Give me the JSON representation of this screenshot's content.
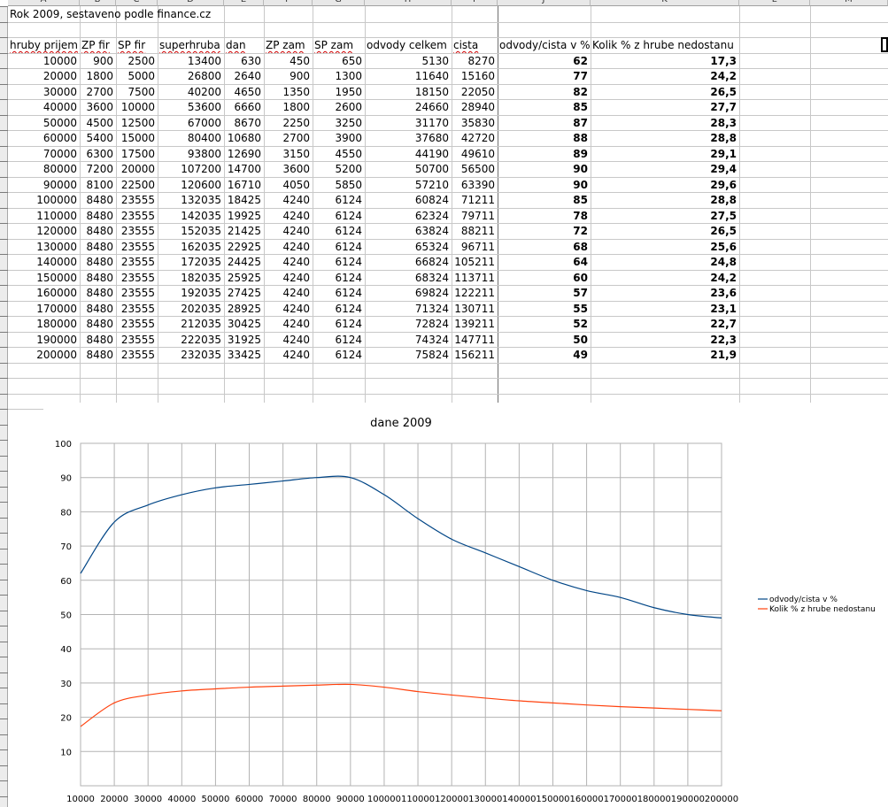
{
  "columns": [
    "A",
    "B",
    "C",
    "D",
    "E",
    "F",
    "G",
    "H",
    "I",
    "J",
    "K",
    "L",
    "M"
  ],
  "title_cell": "Rok 2009, sestaveno podle finance.cz",
  "headers": [
    "hruby prijem",
    "ZP fir",
    "SP fir",
    "superhruba",
    "dan",
    "ZP zam",
    "SP zam",
    "odvody celkem",
    "cista",
    "odvody/cista v %",
    "Kolik % z hrube nedostanu"
  ],
  "rows": [
    [
      "10000",
      "900",
      "2500",
      "13400",
      "630",
      "450",
      "650",
      "5130",
      "8270",
      "62",
      "17,3"
    ],
    [
      "20000",
      "1800",
      "5000",
      "26800",
      "2640",
      "900",
      "1300",
      "11640",
      "15160",
      "77",
      "24,2"
    ],
    [
      "30000",
      "2700",
      "7500",
      "40200",
      "4650",
      "1350",
      "1950",
      "18150",
      "22050",
      "82",
      "26,5"
    ],
    [
      "40000",
      "3600",
      "10000",
      "53600",
      "6660",
      "1800",
      "2600",
      "24660",
      "28940",
      "85",
      "27,7"
    ],
    [
      "50000",
      "4500",
      "12500",
      "67000",
      "8670",
      "2250",
      "3250",
      "31170",
      "35830",
      "87",
      "28,3"
    ],
    [
      "60000",
      "5400",
      "15000",
      "80400",
      "10680",
      "2700",
      "3900",
      "37680",
      "42720",
      "88",
      "28,8"
    ],
    [
      "70000",
      "6300",
      "17500",
      "93800",
      "12690",
      "3150",
      "4550",
      "44190",
      "49610",
      "89",
      "29,1"
    ],
    [
      "80000",
      "7200",
      "20000",
      "107200",
      "14700",
      "3600",
      "5200",
      "50700",
      "56500",
      "90",
      "29,4"
    ],
    [
      "90000",
      "8100",
      "22500",
      "120600",
      "16710",
      "4050",
      "5850",
      "57210",
      "63390",
      "90",
      "29,6"
    ],
    [
      "100000",
      "8480",
      "23555",
      "132035",
      "18425",
      "4240",
      "6124",
      "60824",
      "71211",
      "85",
      "28,8"
    ],
    [
      "110000",
      "8480",
      "23555",
      "142035",
      "19925",
      "4240",
      "6124",
      "62324",
      "79711",
      "78",
      "27,5"
    ],
    [
      "120000",
      "8480",
      "23555",
      "152035",
      "21425",
      "4240",
      "6124",
      "63824",
      "88211",
      "72",
      "26,5"
    ],
    [
      "130000",
      "8480",
      "23555",
      "162035",
      "22925",
      "4240",
      "6124",
      "65324",
      "96711",
      "68",
      "25,6"
    ],
    [
      "140000",
      "8480",
      "23555",
      "172035",
      "24425",
      "4240",
      "6124",
      "66824",
      "105211",
      "64",
      "24,8"
    ],
    [
      "150000",
      "8480",
      "23555",
      "182035",
      "25925",
      "4240",
      "6124",
      "68324",
      "113711",
      "60",
      "24,2"
    ],
    [
      "160000",
      "8480",
      "23555",
      "192035",
      "27425",
      "4240",
      "6124",
      "69824",
      "122211",
      "57",
      "23,6"
    ],
    [
      "170000",
      "8480",
      "23555",
      "202035",
      "28925",
      "4240",
      "6124",
      "71324",
      "130711",
      "55",
      "23,1"
    ],
    [
      "180000",
      "8480",
      "23555",
      "212035",
      "30425",
      "4240",
      "6124",
      "72824",
      "139211",
      "52",
      "22,7"
    ],
    [
      "190000",
      "8480",
      "23555",
      "222035",
      "31925",
      "4240",
      "6124",
      "74324",
      "147711",
      "50",
      "22,3"
    ],
    [
      "200000",
      "8480",
      "23555",
      "232035",
      "33425",
      "4240",
      "6124",
      "75824",
      "156211",
      "49",
      "21,9"
    ]
  ],
  "chart_data": {
    "type": "line",
    "title": "dane 2009",
    "x": [
      10000,
      20000,
      30000,
      40000,
      50000,
      60000,
      70000,
      80000,
      90000,
      100000,
      110000,
      120000,
      130000,
      140000,
      150000,
      160000,
      170000,
      180000,
      190000,
      200000
    ],
    "xlim": [
      10000,
      200000
    ],
    "xticks": [
      "10000",
      "20000",
      "30000",
      "40000",
      "50000",
      "60000",
      "70000",
      "80000",
      "90000",
      "100000",
      "110000",
      "120000",
      "130000",
      "140000",
      "150000",
      "160000",
      "170000",
      "180000",
      "190000",
      "200000"
    ],
    "ylim": [
      0,
      100
    ],
    "yticks": [
      "10",
      "20",
      "30",
      "40",
      "50",
      "60",
      "70",
      "80",
      "90",
      "100"
    ],
    "grid": true,
    "legend_position": "right",
    "series": [
      {
        "name": "odvody/cista v %",
        "color": "#004586",
        "values": [
          62,
          77,
          82,
          85,
          87,
          88,
          89,
          90,
          90,
          85,
          78,
          72,
          68,
          64,
          60,
          57,
          55,
          52,
          50,
          49
        ]
      },
      {
        "name": "Kolik % z hrube nedostanu",
        "color": "#ff420e",
        "values": [
          17.3,
          24.2,
          26.5,
          27.7,
          28.3,
          28.8,
          29.1,
          29.4,
          29.6,
          28.8,
          27.5,
          26.5,
          25.6,
          24.8,
          24.2,
          23.6,
          23.1,
          22.7,
          22.3,
          21.9
        ]
      }
    ]
  }
}
